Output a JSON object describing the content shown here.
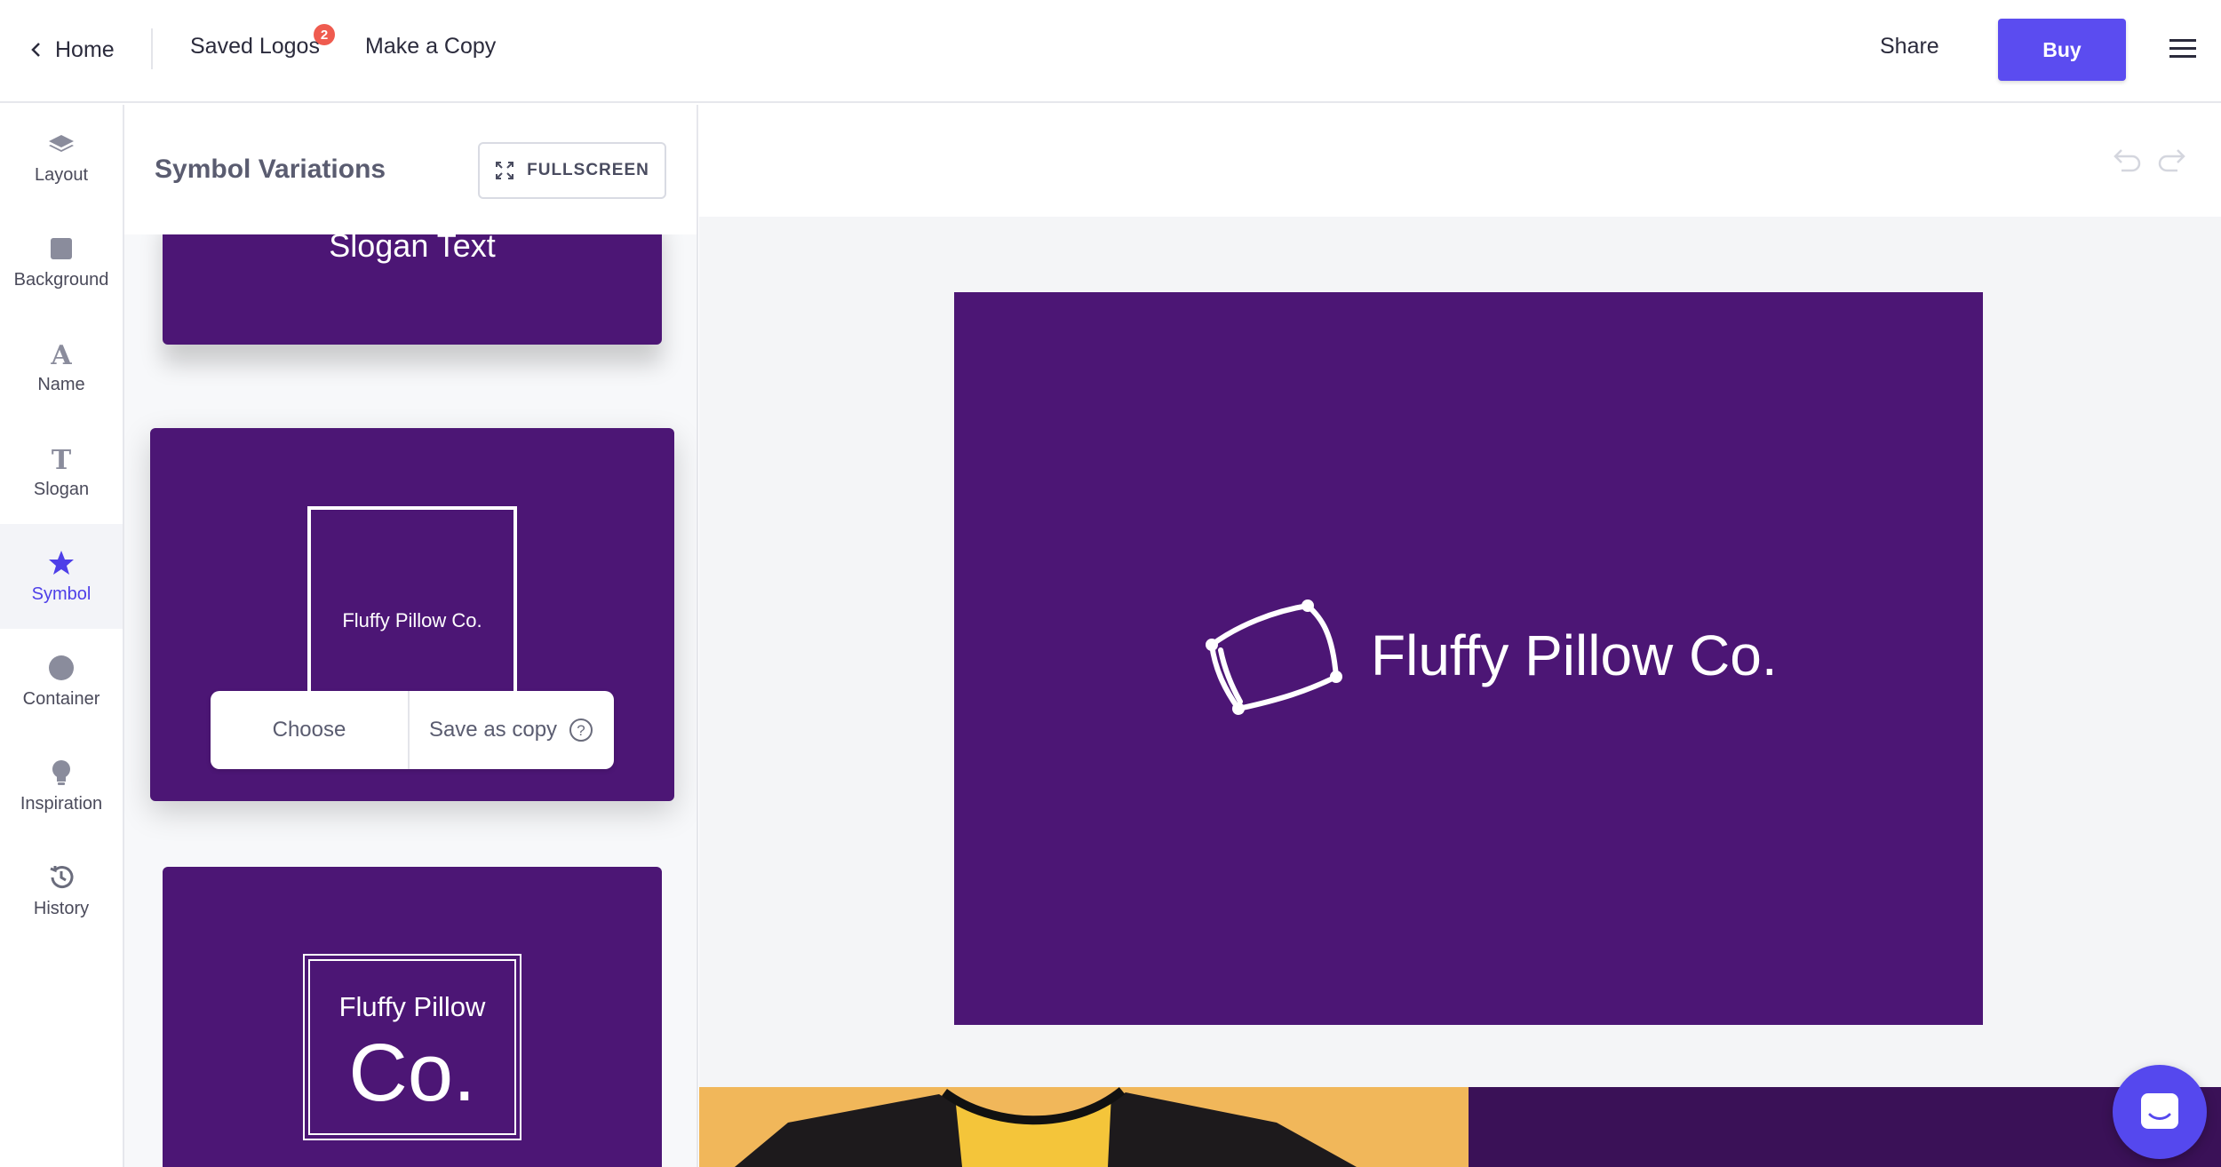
{
  "topbar": {
    "home_label": "Home",
    "saved_logos_label": "Saved Logos",
    "saved_logos_count": "2",
    "make_copy_label": "Make a Copy",
    "share_label": "Share",
    "buy_label": "Buy"
  },
  "rail": {
    "items": [
      {
        "label": "Layout",
        "icon": "layers-icon"
      },
      {
        "label": "Background",
        "icon": "square-icon"
      },
      {
        "label": "Name",
        "icon": "letter-a-icon"
      },
      {
        "label": "Slogan",
        "icon": "letter-t-icon"
      },
      {
        "label": "Symbol",
        "icon": "star-icon",
        "active": true
      },
      {
        "label": "Container",
        "icon": "circle-icon"
      },
      {
        "label": "Inspiration",
        "icon": "lightbulb-icon"
      },
      {
        "label": "History",
        "icon": "history-icon"
      }
    ]
  },
  "panel": {
    "title": "Symbol Variations",
    "fullscreen_label": "FULLSCREEN",
    "cards": [
      {
        "text": "Slogan Text"
      },
      {
        "text": "Fluffy Pillow Co.",
        "choose_label": "Choose",
        "save_copy_label": "Save as copy"
      },
      {
        "line1": "Fluffy Pillow",
        "line2": "Co."
      }
    ]
  },
  "canvas": {
    "company_name": "Fluffy Pillow Co."
  },
  "colors": {
    "brand_purple": "#4c1675",
    "accent": "#5b4cf0",
    "badge": "#ef5b4f",
    "mockup_yellow": "#f1b75a"
  }
}
